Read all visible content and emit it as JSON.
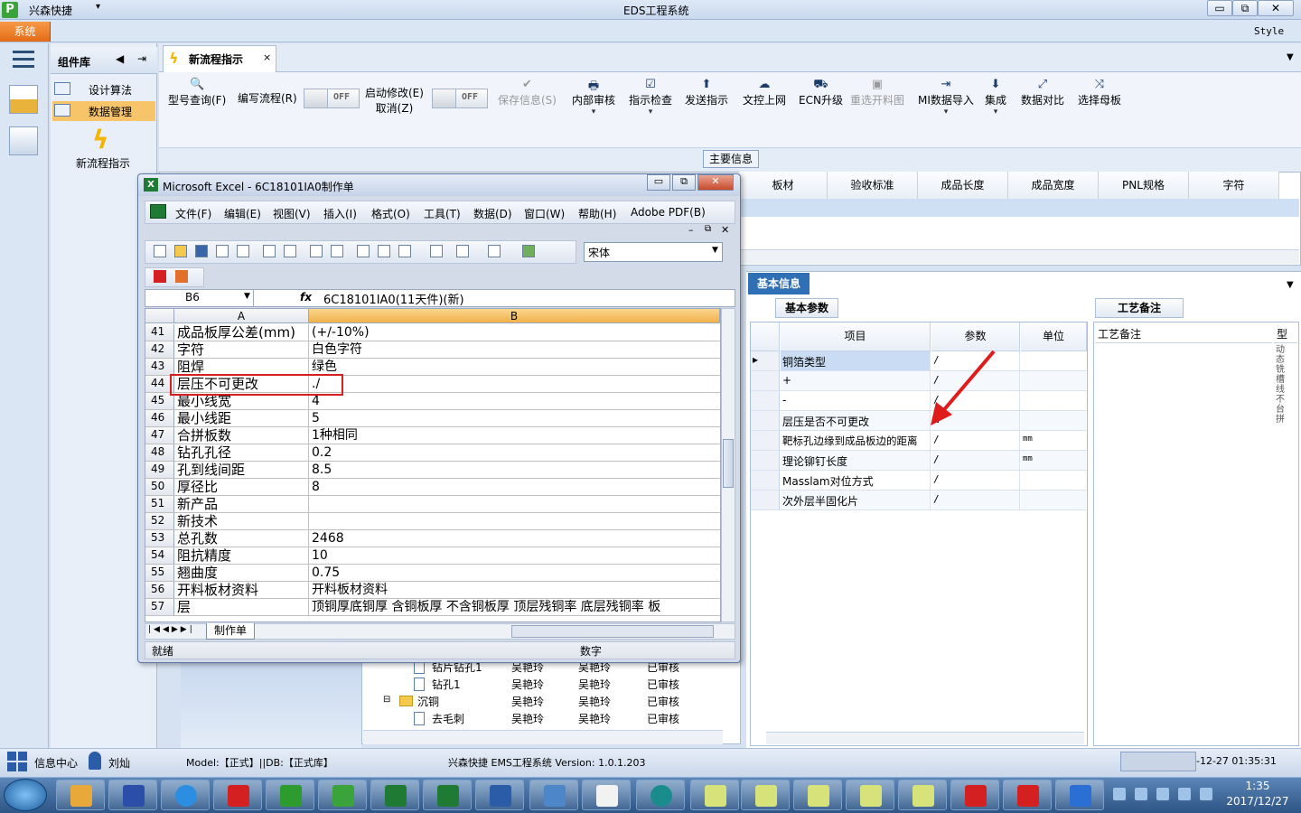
{
  "app": {
    "name": "兴森快捷",
    "window_title": "EDS工程系统",
    "system_button": "系统",
    "style_label": "Style",
    "win_min": "▭",
    "win_max": "⧉",
    "win_close": "✕"
  },
  "component_panel": {
    "title": "组件库",
    "items": [
      {
        "label": "设计算法"
      },
      {
        "label": "数据管理"
      }
    ],
    "new_flow_label": "新流程指示"
  },
  "tab": {
    "label": "新流程指示",
    "close": "×"
  },
  "toolbar": {
    "items": [
      {
        "label": "型号查询(F)",
        "icon": "🔍"
      },
      {
        "label": "编写流程(R)"
      },
      {
        "label": "启动修改(E)",
        "sub": "取消(Z)"
      },
      {
        "label": "保存信息(S)",
        "icon": "✔"
      },
      {
        "label": "内部审核",
        "icon": "🖶"
      },
      {
        "label": "指示检查",
        "icon": "☑"
      },
      {
        "label": "发送指示",
        "icon": "⬆"
      },
      {
        "label": "文控上网",
        "icon": "☁"
      },
      {
        "label": "ECN升级",
        "icon": "⛟"
      },
      {
        "label": "重选开料图",
        "icon": "▣"
      },
      {
        "label": "MI数据导入",
        "icon": "⇥"
      },
      {
        "label": "集成",
        "icon": "⬇"
      },
      {
        "label": "数据对比",
        "icon": "⤢"
      },
      {
        "label": "选择母板",
        "icon": "⤨"
      }
    ],
    "toggle1": "OFF",
    "toggle2": "OFF"
  },
  "main_info": {
    "tab": "主要信息",
    "columns": [
      "板材",
      "验收标准",
      "成品长度",
      "成品宽度",
      "PNL规格",
      "字符"
    ]
  },
  "basic_info": {
    "tab": "基本信息",
    "param_tab": "基本参数",
    "headers": [
      "项目",
      "参数",
      "单位"
    ],
    "rows": [
      {
        "item": "铜箔类型",
        "value": "/",
        "unit": ""
      },
      {
        "item": "+",
        "value": "/",
        "unit": ""
      },
      {
        "item": "-",
        "value": "/",
        "unit": ""
      },
      {
        "item": "层压是否不可更改",
        "value": "N",
        "unit": ""
      },
      {
        "item": "靶标孔边缘到成品板边的距离",
        "value": "/",
        "unit": "mm"
      },
      {
        "item": "理论铆钉长度",
        "value": "/",
        "unit": "mm"
      },
      {
        "item": "Masslam对位方式",
        "value": "/",
        "unit": ""
      },
      {
        "item": "次外层半固化片",
        "value": "/",
        "unit": ""
      }
    ],
    "row_marker": "▸"
  },
  "craft": {
    "tab": "工艺备注",
    "header": "工艺备注",
    "type_header": "型",
    "vertical_text": "动态铣槽线不台拼"
  },
  "tree": {
    "rows": [
      {
        "name": "钻片钻孔1",
        "a": "吴艳玲",
        "b": "吴艳玲",
        "status": "已审核",
        "kind": "file"
      },
      {
        "name": "钻孔1",
        "a": "吴艳玲",
        "b": "吴艳玲",
        "status": "已审核",
        "kind": "file"
      },
      {
        "name": "沉铜",
        "a": "吴艳玲",
        "b": "吴艳玲",
        "status": "已审核",
        "kind": "folder"
      },
      {
        "name": "去毛刺",
        "a": "吴艳玲",
        "b": "吴艳玲",
        "status": "已审核",
        "kind": "file"
      }
    ]
  },
  "excel": {
    "title": "Microsoft Excel - 6C18101IA0制作单",
    "menu": [
      "文件(F)",
      "编辑(E)",
      "视图(V)",
      "插入(I)",
      "格式(O)",
      "工具(T)",
      "数据(D)",
      "窗口(W)",
      "帮助(H)",
      "Adobe PDF(B)"
    ],
    "font": "宋体",
    "name_box": "B6",
    "fx": "fx",
    "formula_value": "6C18101IA0(11天件)(新)",
    "col_a": "A",
    "col_b": "B",
    "rows": [
      {
        "n": "41",
        "a": "成品板厚公差(mm)",
        "b": "(+/-10%)"
      },
      {
        "n": "42",
        "a": "字符",
        "b": "白色字符"
      },
      {
        "n": "43",
        "a": "阻焊",
        "b": "绿色"
      },
      {
        "n": "44",
        "a": "层压不可更改",
        "b": "./"
      },
      {
        "n": "45",
        "a": "最小线宽",
        "b": "4"
      },
      {
        "n": "46",
        "a": "最小线距",
        "b": "5"
      },
      {
        "n": "47",
        "a": "合拼板数",
        "b": "1种相同"
      },
      {
        "n": "48",
        "a": "钻孔孔径",
        "b": "0.2"
      },
      {
        "n": "49",
        "a": "孔到线间距",
        "b": "8.5"
      },
      {
        "n": "50",
        "a": "厚径比",
        "b": "8"
      },
      {
        "n": "51",
        "a": "新产品",
        "b": ""
      },
      {
        "n": "52",
        "a": "新技术",
        "b": ""
      },
      {
        "n": "53",
        "a": "总孔数",
        "b": "2468"
      },
      {
        "n": "54",
        "a": "阻抗精度",
        "b": "10"
      },
      {
        "n": "55",
        "a": "翘曲度",
        "b": "0.75"
      },
      {
        "n": "56",
        "a": "开料板材资料",
        "b": "开料板材资料"
      },
      {
        "n": "57",
        "a": "层",
        "b": "顶铜厚底铜厚 含铜板厚 不含铜板厚 顶层残铜率 底层残铜率 板"
      }
    ],
    "sheet_tab": "制作单",
    "status_ready": "就绪",
    "status_num": "数字"
  },
  "statusbar": {
    "info_center": "信息中心",
    "user": "刘灿",
    "model": "Model:【正式】||DB:【正式库】",
    "version": "兴森快捷 EMS工程系统 Version: 1.0.1.203",
    "datetime": "-12-27 01:35:31"
  },
  "taskbar": {
    "time": "1:35",
    "date": "2017/12/27"
  },
  "colors": {
    "accent": "#2f6fb5",
    "highlight_box": "#d42020",
    "system_button": "#e46b17"
  }
}
